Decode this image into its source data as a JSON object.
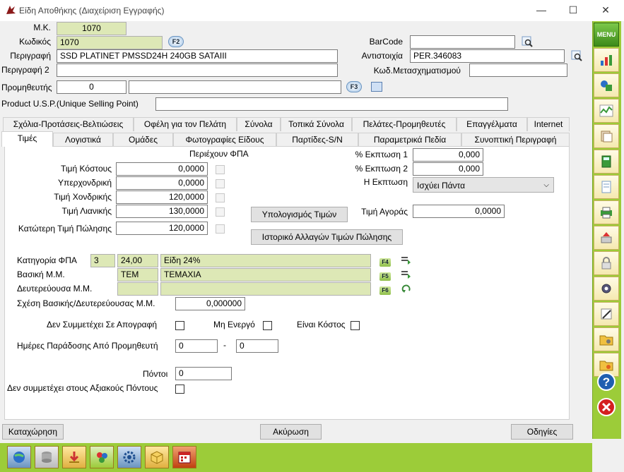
{
  "window": {
    "title": "Είδη Αποθήκης (Διαχείριση Εγγραφής)",
    "min": "—",
    "max": "☐",
    "close": "✕"
  },
  "header": {
    "mk_label": "Μ.Κ.",
    "mk_value": "1070",
    "code_label": "Κωδικός",
    "code_value": "1070",
    "f2": "F2",
    "desc_label": "Περιγραφή",
    "desc_value": "SSD PLATINET PMSSD24H 240GB SATAIII",
    "desc2_label": "Περιγραφή 2",
    "desc2_value": "",
    "supplier_label": "Προμηθευτής",
    "supplier_code": "0",
    "supplier_name": "",
    "f3": "F3",
    "usp_label": "Product U.S.P.(Unique Selling Point)",
    "usp_value": "",
    "barcode_label": "BarCode",
    "barcode_value": "",
    "correspondence_label": "Αντιστοιχία",
    "correspondence_value": "PER.346083",
    "transform_label": "Κωδ.Μετασχηματισμού",
    "transform_value": ""
  },
  "tabs_row1": [
    "Σχόλια-Προτάσεις-Βελτιώσεις",
    "Οφέλη για τον Πελάτη",
    "Σύνολα",
    "Τοπικά Σύνολα",
    "Πελάτες-Προμηθευτές",
    "Επαγγέλματα",
    "Internet"
  ],
  "tabs_row2": [
    "Τιμές",
    "Λογιστικά",
    "Ομάδες",
    "Φωτογραφίες Είδους",
    "Παρτίδες-S/N",
    "Παραμετρικά Πεδία",
    "Συνοπτική Περιγραφή"
  ],
  "prices": {
    "vat_included_label": "Περιέχουν ΦΠΑ",
    "cost_label": "Τιμή Κόστους",
    "cost": "0,0000",
    "wholesale_plus_label": "Υπερχονδρική",
    "wholesale_plus": "0,0000",
    "wholesale_label": "Τιμή Χονδρικής",
    "wholesale": "120,0000",
    "retail_label": "Τιμή Λιανικής",
    "retail": "130,0000",
    "min_label": "Κατώτερη Τιμή Πώλησης",
    "min": "120,0000",
    "disc1_label": "% Εκπτωση 1",
    "disc1": "0,000",
    "disc2_label": "% Εκπτωση 2",
    "disc2": "0,000",
    "discount_label": "Η Εκπτωση",
    "discount_value": "Ισχύει Πάντα",
    "calc_button": "Υπολογισμός Τιμών",
    "purchase_label": "Τιμή Αγοράς",
    "purchase": "0,0000",
    "history_button": "Ιστορικό Αλλαγών Τιμών Πώλησης"
  },
  "vat": {
    "cat_label": "Κατηγορία ΦΠΑ",
    "cat_code": "3",
    "cat_rate": "24,00",
    "cat_name": "Είδη 24%",
    "f4": "F4",
    "unit_label": "Βασική Μ.Μ.",
    "unit_code": "TEM",
    "unit_name": "TEMAXIA",
    "f5": "F5",
    "unit2_label": "Δευτερεύουσα Μ.Μ.",
    "unit2_code": "",
    "unit2_name": "",
    "f6": "F6",
    "ratio_label": "Σχέση Βασικής/Δευτερεύουσας Μ.Μ.",
    "ratio": "0,000000"
  },
  "flags": {
    "no_inventory_label": "Δεν Συμμετέχει Σε Απογραφή",
    "inactive_label": "Μη Ενεργό",
    "is_cost_label": "Είναι Κόστος",
    "delivery_label": "Ημέρες Παράδοσης Από Προμηθευτή",
    "delivery_from": "0",
    "dash": "-",
    "delivery_to": "0",
    "points_label": "Πόντοι",
    "points": "0",
    "no_points_label": "Δεν συμμετέχει στους Αξιακούς Πόντους"
  },
  "footer": {
    "save": "Καταχώρηση",
    "cancel": "Ακύρωση",
    "help": "Οδηγίες"
  },
  "sidebar": {
    "menu": "MENU"
  },
  "colors": {
    "green_bar": "#9ccc39",
    "field_green": "#dde8b6"
  }
}
